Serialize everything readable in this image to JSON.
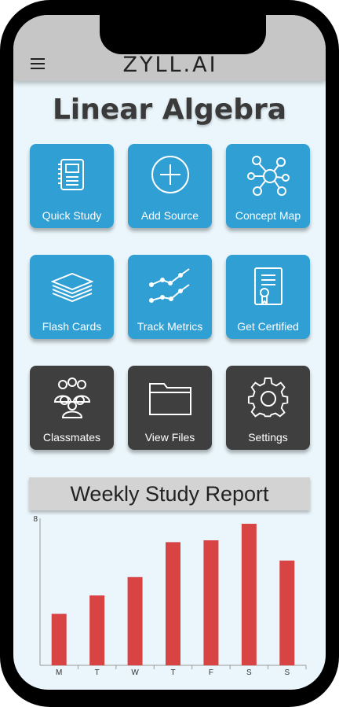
{
  "header": {
    "logo": "ZYLL.AI"
  },
  "page": {
    "title": "Linear Algebra"
  },
  "tiles": [
    {
      "label": "Quick Study",
      "icon": "notebook-icon",
      "color": "#2f9fd4"
    },
    {
      "label": "Add Source",
      "icon": "plus-circle-icon",
      "color": "#2f9fd4"
    },
    {
      "label": "Concept Map",
      "icon": "network-icon",
      "color": "#2f9fd4"
    },
    {
      "label": "Flash Cards",
      "icon": "card-stack-icon",
      "color": "#2f9fd4"
    },
    {
      "label": "Track Metrics",
      "icon": "line-chart-icon",
      "color": "#2f9fd4"
    },
    {
      "label": "Get Certified",
      "icon": "certificate-icon",
      "color": "#2f9fd4"
    },
    {
      "label": "Classmates",
      "icon": "people-group-icon",
      "color": "#3f3f3f"
    },
    {
      "label": "View Files",
      "icon": "folder-icon",
      "color": "#3f3f3f"
    },
    {
      "label": "Settings",
      "icon": "gear-icon",
      "color": "#3f3f3f"
    }
  ],
  "report": {
    "title": "Weekly Study Report"
  },
  "chart_data": {
    "type": "bar",
    "categories": [
      "M",
      "T",
      "W",
      "T",
      "F",
      "S",
      "S"
    ],
    "values": [
      2.8,
      3.8,
      4.8,
      6.7,
      6.8,
      7.7,
      5.7
    ],
    "ylim": [
      0,
      8
    ],
    "yticks": [
      8
    ],
    "bar_color": "#d84444",
    "grid": false
  }
}
